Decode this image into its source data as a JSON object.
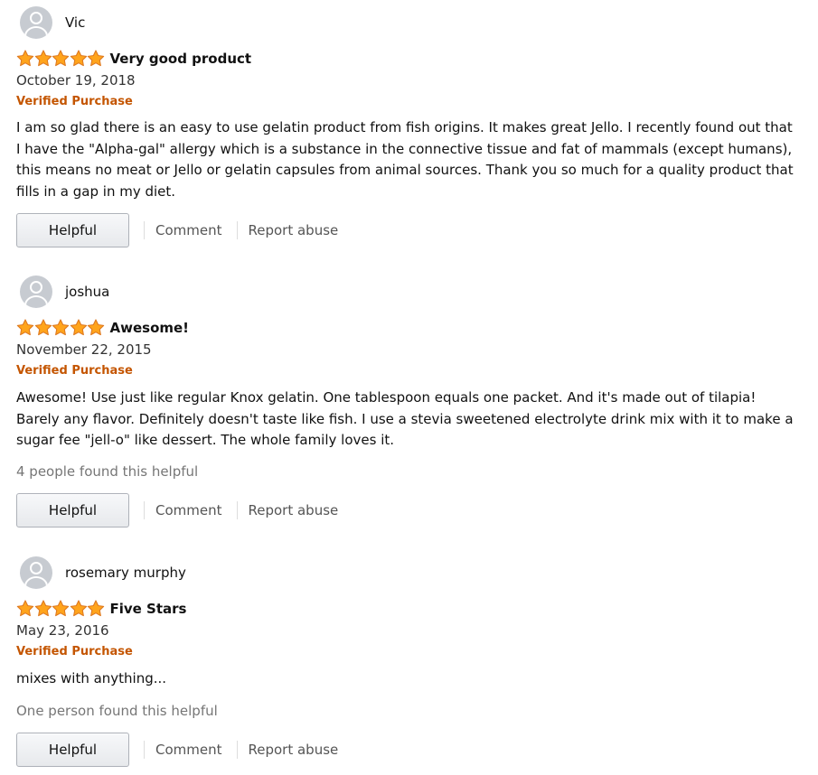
{
  "buttons": {
    "helpful": "Helpful",
    "comment": "Comment",
    "report": "Report abuse"
  },
  "colors": {
    "verified": "#c45500",
    "star": "#ffa41c",
    "star_outline": "#de7921"
  },
  "reviews": [
    {
      "reviewer": "Vic",
      "rating": 5,
      "title": "Very good product",
      "date": "October 19, 2018",
      "verified": "Verified Purchase",
      "body": "I am so glad there is an easy to use gelatin product from fish origins. It makes great Jello. I recently found out that I have the \"Alpha-gal\" allergy which is a substance in the connective tissue and fat of mammals (except humans), this means no meat or Jello or gelatin capsules from animal sources. Thank you so much for a quality product that fills in a gap in my diet.",
      "helpful_count": ""
    },
    {
      "reviewer": "joshua",
      "rating": 5,
      "title": "Awesome!",
      "date": "November 22, 2015",
      "verified": "Verified Purchase",
      "body": "Awesome! Use just like regular Knox gelatin. One tablespoon equals one packet. And it's made out of tilapia! Barely any flavor. Definitely doesn't taste like fish. I use a stevia sweetened electrolyte drink mix with it to make a sugar fee \"jell-o\" like dessert. The whole family loves it.",
      "helpful_count": "4 people found this helpful"
    },
    {
      "reviewer": "rosemary murphy",
      "rating": 5,
      "title": "Five Stars",
      "date": "May 23, 2016",
      "verified": "Verified Purchase",
      "body": "mixes with anything...",
      "helpful_count": "One person found this helpful"
    }
  ]
}
